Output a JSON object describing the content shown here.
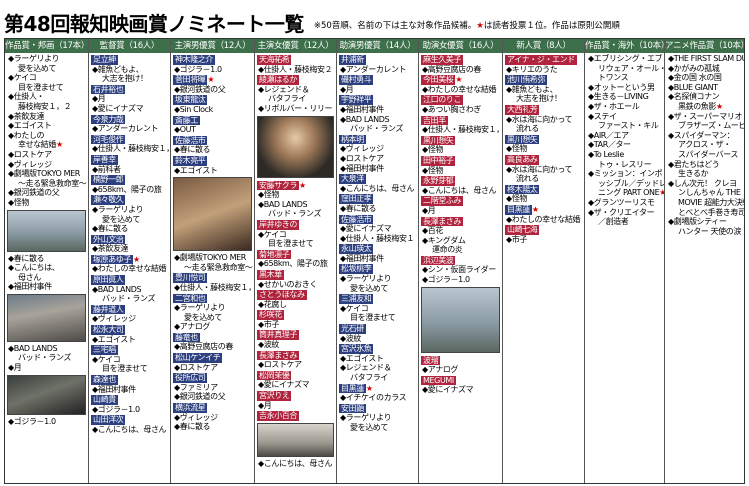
{
  "header": {
    "title": "第48回報知映画賞ノミネート一覧",
    "note": "※50音順、名前の下は主な対象作品候補。",
    "note_star": "★",
    "note_tail": "は読者投票１位。作品は原則公開順"
  },
  "columns": [
    {
      "id": "picture",
      "head": "作品賞・邦画（17本）",
      "items": [
        {
          "t": "◆ラーゲリより",
          "c": "愛を込めて"
        },
        {
          "t": "◆ケイコ",
          "c": "目を澄ませて"
        },
        {
          "t": "◆仕掛人・",
          "c": "藤枝梅安１，２"
        },
        {
          "t": "◆茶飲友達"
        },
        {
          "t": "◆エゴイスト"
        },
        {
          "t": "◆わたしの",
          "c": "幸せな結婚",
          "star": true
        },
        {
          "t": "◆ロストケア"
        },
        {
          "t": "◆ヴィレッジ"
        },
        {
          "t": "◆劇場版TOKYO MER",
          "c": "～走る緊急救命室～"
        },
        {
          "t": "◆銀河鉄道の父"
        },
        {
          "t": "◆怪物"
        },
        {
          "ph": "sky",
          "h": 42
        },
        {
          "t": "◆春に散る"
        },
        {
          "t": "◆こんにちは、",
          "c": "母さん"
        },
        {
          "t": "◆福田村事件"
        },
        {
          "ph": "crowd",
          "h": 48
        },
        {
          "t": "◆BAD LANDS",
          "c": "バッド・ランズ"
        },
        {
          "t": "◆月"
        },
        {
          "ph": "dark",
          "h": 40
        },
        {
          "t": "◆ゴジラ－1.0"
        }
      ]
    },
    {
      "id": "director",
      "head": "監督賞（16人）",
      "items": [
        {
          "n": "足立紳"
        },
        {
          "t": "◆雑魚どもよ、",
          "c": "大志を抱け！"
        },
        {
          "n": "石井裕也"
        },
        {
          "t": "◆月"
        },
        {
          "t": "◆愛にイナズマ"
        },
        {
          "n": "今泉力哉"
        },
        {
          "t": "◆アンダーカレント"
        },
        {
          "n": "河毛俊作"
        },
        {
          "t": "◆仕掛人・藤枝梅安１，２"
        },
        {
          "n": "岸善幸"
        },
        {
          "t": "◆前科者"
        },
        {
          "n": "楠野一郎"
        },
        {
          "t": "◆658km、陽子の旅"
        },
        {
          "n": "瀬々敬久"
        },
        {
          "t": "◆ラーゲリより",
          "c": "愛を込めて"
        },
        {
          "t": "◆春に散る"
        },
        {
          "n": "外山文治"
        },
        {
          "t": "◆茶飲友達"
        },
        {
          "n": "塚原あゆ子",
          "star": true
        },
        {
          "t": "◆わたしの幸せな結婚"
        },
        {
          "n": "原田眞人"
        },
        {
          "t": "◆BAD LANDS",
          "c": "バッド・ランズ"
        },
        {
          "n": "藤井道人"
        },
        {
          "t": "◆ヴィレッジ"
        },
        {
          "n": "松永大司"
        },
        {
          "t": "◆エゴイスト"
        },
        {
          "n": "三宅唱"
        },
        {
          "t": "◆ケイコ",
          "c": "目を澄ませて"
        },
        {
          "n": "森達也"
        },
        {
          "t": "◆福田村事件"
        },
        {
          "n": "山崎貴"
        },
        {
          "t": "◆ゴジラ－1.0"
        },
        {
          "n": "山田洋次"
        },
        {
          "t": "◆こんにちは、母さん"
        }
      ]
    },
    {
      "id": "actor",
      "head": "主演男優賞（12人）",
      "items": [
        {
          "n": "神木隆之介"
        },
        {
          "t": "◆ゴジラ－1.0"
        },
        {
          "n": "菅田将暉",
          "star": true
        },
        {
          "t": "◆銀河鉄道の父"
        },
        {
          "n": "坂東龍汰"
        },
        {
          "t": "◆Sin Clock"
        },
        {
          "n": "斎藤工"
        },
        {
          "t": "◆OUT"
        },
        {
          "n": "佐藤浩市"
        },
        {
          "t": "◆春に散る"
        },
        {
          "n": "鈴木亮平"
        },
        {
          "t": "◆エゴイスト"
        },
        {
          "ph": "warm",
          "h": 74
        },
        {
          "t": "◆劇場版TOKYO MER",
          "c": "～走る緊急救命室～"
        },
        {
          "n": "豊川悦司"
        },
        {
          "t": "◆仕掛人・藤枝梅安１，２"
        },
        {
          "n": "二宮和也"
        },
        {
          "t": "◆ラーゲリより",
          "c": "愛を込めて"
        },
        {
          "t": "◆アナログ"
        },
        {
          "n": "藤竜也"
        },
        {
          "t": "◆高野豆腐店の春"
        },
        {
          "n": "松山ケンイチ"
        },
        {
          "t": "◆ロストケア"
        },
        {
          "n": "役所広司"
        },
        {
          "t": "◆ファミリア"
        },
        {
          "t": "◆銀河鉄道の父"
        },
        {
          "n": "横浜流星"
        },
        {
          "t": "◆ヴィレッジ"
        },
        {
          "t": "◆春に散る"
        }
      ]
    },
    {
      "id": "actress",
      "head": "主演女優賞（12人）",
      "items": [
        {
          "n": "天海祐希",
          "f": true
        },
        {
          "t": "◆仕掛人・藤枝梅安２"
        },
        {
          "n": "綾瀬はるか",
          "f": true
        },
        {
          "t": "◆レジェンド＆",
          "c": "バタフライ"
        },
        {
          "t": "◆リボルバー・リリー"
        },
        {
          "ph": "face",
          "h": 62
        },
        {
          "n": "安藤サクラ",
          "f": true,
          "star": true
        },
        {
          "t": "◆怪物"
        },
        {
          "t": "◆BAD LANDS",
          "c": "バッド・ランズ"
        },
        {
          "n": "岸井ゆきの",
          "f": true
        },
        {
          "t": "◆ケイコ",
          "c": "目を澄ませて"
        },
        {
          "n": "菊地凛子",
          "f": true
        },
        {
          "t": "◆658km、陽子の旅"
        },
        {
          "n": "黒木華",
          "f": true
        },
        {
          "t": "◆せかいのおきく"
        },
        {
          "n": "さとうほなみ",
          "f": true
        },
        {
          "t": "◆花腐し"
        },
        {
          "n": "杉咲花",
          "f": true
        },
        {
          "t": "◆市子"
        },
        {
          "n": "筒井真理子",
          "f": true
        },
        {
          "t": "◆波紋"
        },
        {
          "n": "長澤まさみ",
          "f": true
        },
        {
          "t": "◆ロストケア"
        },
        {
          "n": "松岡茉優",
          "f": true
        },
        {
          "t": "◆愛にイナズマ"
        },
        {
          "n": "宮沢りえ",
          "f": true
        },
        {
          "t": "◆月"
        },
        {
          "n": "吉永小百合",
          "f": true
        },
        {
          "ph": "soft",
          "h": 34
        },
        {
          "t": "◆こんにちは、母さん"
        }
      ]
    },
    {
      "id": "supp-actor",
      "head": "助演男優賞（14人）",
      "items": [
        {
          "n": "井浦新"
        },
        {
          "t": "◆アンダーカレント"
        },
        {
          "n": "磯村勇斗"
        },
        {
          "t": "◆月"
        },
        {
          "n": "宇野祥平"
        },
        {
          "t": "◆福田村事件"
        },
        {
          "t": "◆BAD LANDS",
          "c": "バッド・ランズ"
        },
        {
          "n": "柄本明"
        },
        {
          "t": "◆ヴィレッジ"
        },
        {
          "t": "◆ロストケア"
        },
        {
          "t": "◆福田村事件"
        },
        {
          "n": "大泉洋"
        },
        {
          "t": "◆こんにちは、母さん"
        },
        {
          "n": "窪田正孝"
        },
        {
          "t": "◆春に散る"
        },
        {
          "n": "佐藤浩市"
        },
        {
          "t": "◆愛にイナズマ"
        },
        {
          "t": "◆仕掛人・藤枝梅安１"
        },
        {
          "n": "永山瑛太"
        },
        {
          "t": "◆福田村事件"
        },
        {
          "n": "松坂桃李"
        },
        {
          "t": "◆ラーゲリより",
          "c": "愛を込めて"
        },
        {
          "n": "三浦友和"
        },
        {
          "t": "◆ケイコ",
          "c": "目を澄ませて"
        },
        {
          "n": "光石研"
        },
        {
          "t": "◆波紋"
        },
        {
          "n": "宮沢氷魚"
        },
        {
          "t": "◆エゴイスト"
        },
        {
          "t": "◆レジェンド＆",
          "c": "バタフライ"
        },
        {
          "n": "目黒蓮",
          "star": true
        },
        {
          "t": "◆イチケイのカラス"
        },
        {
          "n": "安田顕"
        },
        {
          "t": "◆ラーゲリより",
          "c": "愛を込めて"
        }
      ]
    },
    {
      "id": "supp-actress",
      "head": "助演女優賞（16人）",
      "items": [
        {
          "n": "麻生久美子",
          "f": true
        },
        {
          "t": "◆高野豆腐店の春"
        },
        {
          "n": "今田美桜",
          "f": true,
          "star": true
        },
        {
          "t": "◆わたしの幸せな結婚"
        },
        {
          "n": "江口のりこ",
          "f": true
        },
        {
          "t": "◆あつい胸さわぎ"
        },
        {
          "n": "吉田羊",
          "f": true
        },
        {
          "t": "◆仕掛人・藤枝梅安１，２"
        },
        {
          "n": "黒川想矢",
          "f": true
        },
        {
          "t": "◆怪物"
        },
        {
          "n": "田中裕子",
          "f": true
        },
        {
          "t": "◆怪物"
        },
        {
          "n": "永野芽郁",
          "f": true
        },
        {
          "t": "◆こんにちは、母さん"
        },
        {
          "n": "二階堂ふみ",
          "f": true
        },
        {
          "t": "◆月"
        },
        {
          "n": "長澤まさみ",
          "f": true
        },
        {
          "t": "◆百花"
        },
        {
          "t": "◆キングダム",
          "c": "運命の炎"
        },
        {
          "n": "浜辺美波",
          "f": true
        },
        {
          "t": "◆シン・仮面ライダー"
        },
        {
          "t": "◆ゴジラ－1.0"
        },
        {
          "ph": "sky",
          "h": 66
        },
        {
          "n": "波瑠",
          "f": true
        },
        {
          "t": "◆アナログ"
        },
        {
          "n": "MEGUMI",
          "f": true
        },
        {
          "t": "◆愛にイナズマ"
        }
      ]
    },
    {
      "id": "newcomer",
      "head": "新人賞（8人）",
      "items": [
        {
          "n": "アイナ・ジ・エンド",
          "f": true
        },
        {
          "t": "◆キリエのうた"
        },
        {
          "n": "池川侑希弥"
        },
        {
          "t": "◆雑魚どもよ、",
          "c": "大志を抱け！"
        },
        {
          "n": "大西礼芳",
          "f": true
        },
        {
          "t": "◆水は海に向かって",
          "c": "流れる"
        },
        {
          "n": "黒川想矢"
        },
        {
          "t": "◆怪物"
        },
        {
          "n": "高良あみ",
          "f": true
        },
        {
          "t": "◆水は海に向かって",
          "c": "流れる"
        },
        {
          "n": "柊木陽太"
        },
        {
          "t": "◆怪物"
        },
        {
          "n": "目黒蓮",
          "star": true
        },
        {
          "t": "◆わたしの幸せな結婚"
        },
        {
          "n": "山崎七海",
          "f": true
        },
        {
          "t": "◆市子"
        }
      ]
    },
    {
      "id": "foreign",
      "head": "作品賞・海外（10本）",
      "items": [
        {
          "t": "◆エブリシング・エブ",
          "c": "リウェア・オール・アッ"
        },
        {
          "t": "",
          "c": "トワンス"
        },
        {
          "t": "◆オットーという男"
        },
        {
          "t": "◆生きる－LIVING"
        },
        {
          "t": "◆ザ・ホエール"
        },
        {
          "t": "◆ステイ",
          "c": "ファースト・キル"
        },
        {
          "t": "◆AIR／エア"
        },
        {
          "t": "◆TAR／ター"
        },
        {
          "t": "◆To Leslie",
          "c": "トゥ・レスリー"
        },
        {
          "t": "◆ミッション：インポ",
          "c": "ッシブル／デッドレコ"
        },
        {
          "t": "",
          "c": "ニング PART ONE",
          "star": true
        },
        {
          "t": "◆グランツーリスモ"
        },
        {
          "t": "◆ザ・クリエイター",
          "c": "／創造者"
        }
      ]
    },
    {
      "id": "anime",
      "head": "アニメ作品賞（10本）",
      "items": [
        {
          "t": "◆THE FIRST SLAM DUNK"
        },
        {
          "t": "◆かがみの孤城"
        },
        {
          "t": "◆金の国 水の国"
        },
        {
          "t": "◆BLUE GIANT"
        },
        {
          "t": "◆名探偵コナン",
          "c": "黒鉄の魚影",
          "star": true
        },
        {
          "t": "◆ザ・スーパーマリオ",
          "c": "ブラザーズ・ムービー"
        },
        {
          "t": "◆スパイダーマン：",
          "c": "アクロス・ザ・"
        },
        {
          "t": "",
          "c": "スパイダーバース"
        },
        {
          "t": "◆君たちはどう",
          "c": "生きるか"
        },
        {
          "t": "◆しん次元！ クレヨ",
          "c": "ンしんちゃん THE"
        },
        {
          "t": "",
          "c": "MOVIE 超能力大決戦～"
        },
        {
          "t": "",
          "c": "とべとべ手巻き寿司～"
        },
        {
          "t": "◆劇場版シティー",
          "c": "ハンター 天使の涙"
        }
      ]
    }
  ]
}
